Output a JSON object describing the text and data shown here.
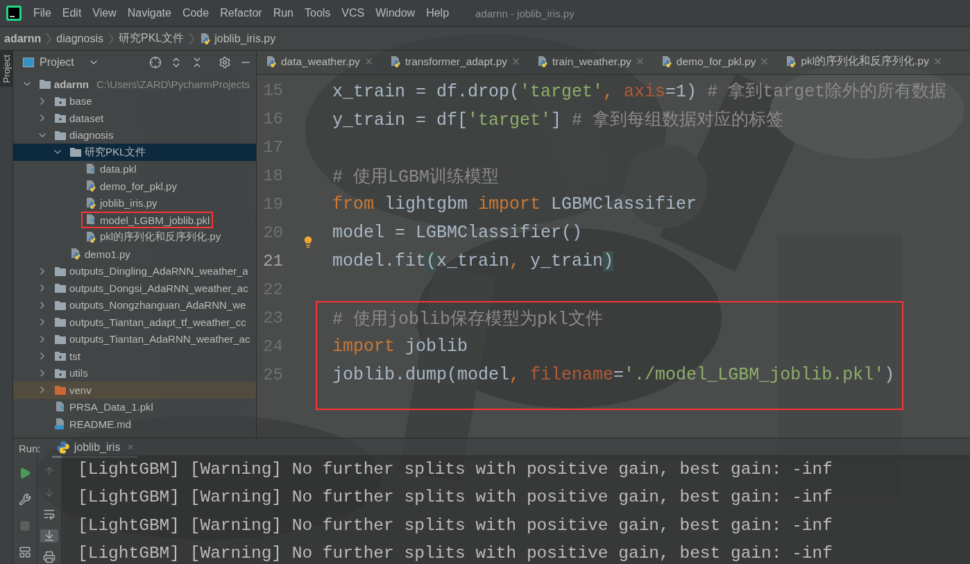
{
  "menu": [
    "File",
    "Edit",
    "View",
    "Navigate",
    "Code",
    "Refactor",
    "Run",
    "Tools",
    "VCS",
    "Window",
    "Help"
  ],
  "window": {
    "title": "adarnn - joblib_iris.py"
  },
  "breadcrumb": [
    {
      "label": "adarnn",
      "kind": "project"
    },
    {
      "label": "diagnosis",
      "kind": "folder"
    },
    {
      "label": "研究PKL文件",
      "kind": "folder"
    },
    {
      "label": "joblib_iris.py",
      "kind": "python"
    }
  ],
  "side_stripe": {
    "label": "Project"
  },
  "project_panel": {
    "title": "Project"
  },
  "tree": [
    {
      "label": "adarnn",
      "path": "C:\\Users\\ZARD\\PycharmProjects",
      "kind": "folder",
      "expanded": true,
      "selected": false,
      "boxed": false,
      "children": [
        {
          "label": "base",
          "kind": "module",
          "expanded": false,
          "selected": false,
          "boxed": false
        },
        {
          "label": "dataset",
          "kind": "module",
          "expanded": false,
          "selected": false,
          "boxed": false
        },
        {
          "label": "diagnosis",
          "kind": "folder",
          "expanded": true,
          "selected": false,
          "boxed": false,
          "children": [
            {
              "label": "研究PKL文件",
              "kind": "folder",
              "expanded": true,
              "selected": true,
              "boxed": false,
              "children": [
                {
                  "label": "data.pkl",
                  "kind": "unknown",
                  "selected": false,
                  "boxed": false
                },
                {
                  "label": "demo_for_pkl.py",
                  "kind": "python",
                  "selected": false,
                  "boxed": false
                },
                {
                  "label": "joblib_iris.py",
                  "kind": "python",
                  "selected": false,
                  "boxed": false
                },
                {
                  "label": "model_LGBM_joblib.pkl",
                  "kind": "unknown",
                  "selected": false,
                  "boxed": true
                },
                {
                  "label": "pkl的序列化和反序列化.py",
                  "kind": "python",
                  "selected": false,
                  "boxed": false
                }
              ]
            },
            {
              "label": "demo1.py",
              "kind": "python",
              "selected": false,
              "boxed": false
            }
          ]
        },
        {
          "label": "outputs_Dingling_AdaRNN_weather_a",
          "kind": "folder",
          "expanded": false,
          "selected": false,
          "boxed": false
        },
        {
          "label": "outputs_Dongsi_AdaRNN_weather_ac",
          "kind": "folder",
          "expanded": false,
          "selected": false,
          "boxed": false
        },
        {
          "label": "outputs_Nongzhanguan_AdaRNN_we",
          "kind": "folder",
          "expanded": false,
          "selected": false,
          "boxed": false
        },
        {
          "label": "outputs_Tiantan_adapt_tf_weather_cc",
          "kind": "folder",
          "expanded": false,
          "selected": false,
          "boxed": false
        },
        {
          "label": "outputs_Tiantan_AdaRNN_weather_ac",
          "kind": "folder",
          "expanded": false,
          "selected": false,
          "boxed": false
        },
        {
          "label": "tst",
          "kind": "module",
          "expanded": false,
          "selected": false,
          "boxed": false
        },
        {
          "label": "utils",
          "kind": "module",
          "expanded": false,
          "selected": false,
          "boxed": false
        },
        {
          "label": "venv",
          "kind": "excluded",
          "expanded": false,
          "selected": false,
          "boxed": false
        },
        {
          "label": "PRSA_Data_1.pkl",
          "kind": "unknown",
          "selected": false,
          "boxed": false
        },
        {
          "label": "README.md",
          "kind": "markdown",
          "selected": false,
          "boxed": false
        }
      ]
    }
  ],
  "tabs": [
    {
      "label": "data_weather.py",
      "selected": false
    },
    {
      "label": "transformer_adapt.py",
      "selected": false
    },
    {
      "label": "train_weather.py",
      "selected": false
    },
    {
      "label": "demo_for_pkl.py",
      "selected": false
    },
    {
      "label": "pkl的序列化和反序列化.py",
      "selected": false
    }
  ],
  "code_blocks": [
    {
      "boxed": false,
      "lines": [
        {
          "number": "15",
          "current": false,
          "intention": false,
          "tokens": [
            {
              "kind": "plain",
              "text": "x_train = df.drop("
            },
            {
              "kind": "string",
              "text": "'target'"
            },
            {
              "kind": "punct",
              "text": ", "
            },
            {
              "kind": "param",
              "text": "axis"
            },
            {
              "kind": "plain",
              "text": "=1) "
            },
            {
              "kind": "comment",
              "text": "# 拿到target除外的所有数据"
            }
          ]
        },
        {
          "number": "16",
          "current": false,
          "intention": false,
          "tokens": [
            {
              "kind": "plain",
              "text": "y_train = df["
            },
            {
              "kind": "string",
              "text": "'target'"
            },
            {
              "kind": "plain",
              "text": "] "
            },
            {
              "kind": "comment",
              "text": "# 拿到每组数据对应的标签"
            }
          ]
        },
        {
          "number": "17",
          "current": false,
          "intention": false
        },
        {
          "number": "18",
          "current": false,
          "intention": false,
          "tokens": [
            {
              "kind": "comment",
              "text": "# 使用LGBM训练模型"
            }
          ]
        },
        {
          "number": "19",
          "current": false,
          "intention": false,
          "tokens": [
            {
              "kind": "keyword",
              "text": "from"
            },
            {
              "kind": "plain",
              "text": " lightgbm "
            },
            {
              "kind": "keyword",
              "text": "import"
            },
            {
              "kind": "plain",
              "text": " LGBMClassifier"
            }
          ]
        },
        {
          "number": "20",
          "current": false,
          "intention": true,
          "tokens": [
            {
              "kind": "plain",
              "text": "model = LGBMClassifier()"
            }
          ]
        },
        {
          "number": "21",
          "current": true,
          "intention": false,
          "tokens": [
            {
              "kind": "plain",
              "text": "model.fit"
            },
            {
              "kind": "paren",
              "text": "("
            },
            {
              "kind": "plain",
              "text": "x_train"
            },
            {
              "kind": "punct",
              "text": ","
            },
            {
              "kind": "plain",
              "text": " y_train"
            },
            {
              "kind": "paren",
              "text": ")"
            }
          ]
        },
        {
          "number": "22",
          "current": false,
          "intention": false
        }
      ]
    },
    {
      "boxed": true,
      "lines": [
        {
          "number": "23",
          "current": false,
          "intention": false,
          "tokens": [
            {
              "kind": "comment",
              "text": "# 使用joblib保存模型为pkl文件"
            }
          ]
        },
        {
          "number": "24",
          "current": false,
          "intention": false,
          "tokens": [
            {
              "kind": "keyword",
              "text": "import"
            },
            {
              "kind": "plain",
              "text": " joblib"
            }
          ]
        },
        {
          "number": "25",
          "current": false,
          "intention": false,
          "tokens": [
            {
              "kind": "plain",
              "text": "joblib.dump(model"
            },
            {
              "kind": "punct",
              "text": ", "
            },
            {
              "kind": "param",
              "text": "filename"
            },
            {
              "kind": "plain",
              "text": "="
            },
            {
              "kind": "string",
              "text": "'./model_LGBM_joblib.pkl'"
            },
            {
              "kind": "plain",
              "text": ")"
            }
          ]
        }
      ]
    }
  ],
  "run_panel": {
    "label": "Run:",
    "tab": "joblib_iris",
    "close": "×",
    "output": [
      "[LightGBM] [Warning] No further splits with positive gain, best gain: -inf",
      "[LightGBM] [Warning] No further splits with positive gain, best gain: -inf",
      "[LightGBM] [Warning] No further splits with positive gain, best gain: -inf",
      "[LightGBM] [Warning] No further splits with positive gain, best gain: -inf"
    ]
  }
}
